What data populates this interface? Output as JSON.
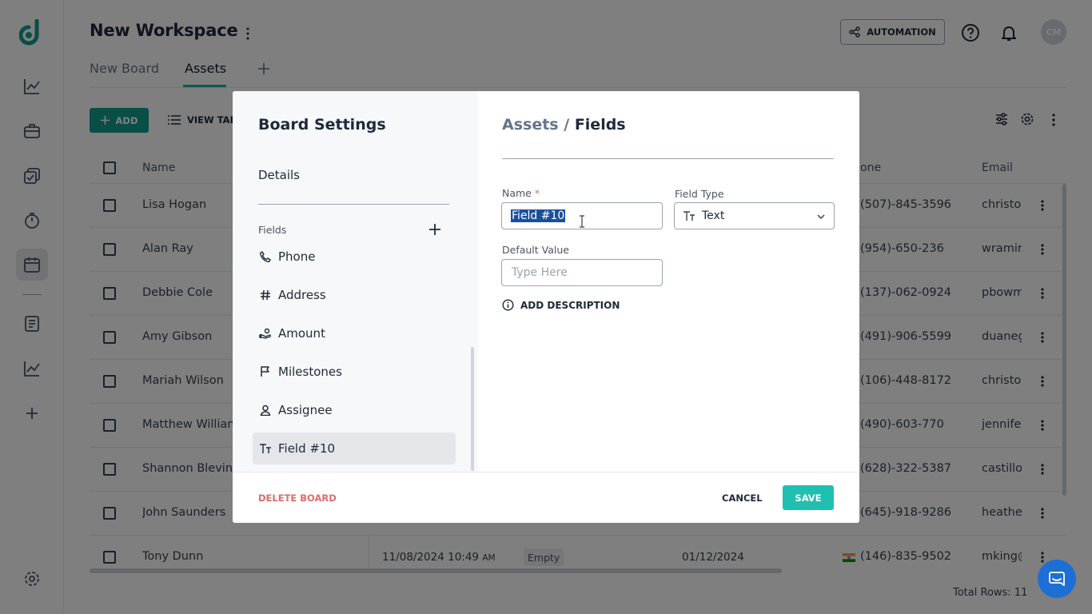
{
  "workspace": {
    "title": "New Workspace",
    "tabs": [
      {
        "label": "New Board"
      },
      {
        "label": "Assets"
      }
    ],
    "automation_label": "AUTOMATION",
    "avatar_initials": "CM"
  },
  "toolbar": {
    "add_label": "ADD",
    "view_table_label": "VIEW TAB"
  },
  "table": {
    "headers": {
      "name": "Name",
      "phone": "one",
      "email": "Email"
    },
    "rows": [
      {
        "name": "Lisa Hogan",
        "phone": "(507)-845-3596",
        "email": "christo"
      },
      {
        "name": "Alan Ray",
        "phone": "(954)-650-236",
        "email": "wramir"
      },
      {
        "name": "Debbie Cole",
        "phone": "(137)-062-0924",
        "email": "pbowm"
      },
      {
        "name": "Amy Gibson",
        "phone": "(491)-906-5599",
        "email": "duaneg"
      },
      {
        "name": "Mariah Wilson",
        "phone": "(106)-448-8172",
        "email": "christo"
      },
      {
        "name": "Matthew William",
        "phone": "(490)-603-770",
        "email": "jennifer"
      },
      {
        "name": "Shannon Blevins",
        "phone": "(628)-322-5387",
        "email": "castillo"
      },
      {
        "name": "John Saunders",
        "phone": "(645)-918-9286",
        "email": "heathe"
      },
      {
        "name": "Tony Dunn",
        "date": "11/08/2024 10:49",
        "date_suffix": "AM",
        "status": "Empty",
        "date2": "01/12/2024",
        "phone": "(146)-835-9502",
        "email": "mking@"
      }
    ],
    "total_rows": "Total Rows: 11"
  },
  "modal": {
    "title": "Board Settings",
    "details_label": "Details",
    "fields_label": "Fields",
    "fields": [
      {
        "label": "Phone",
        "icon": "phone-icon"
      },
      {
        "label": "Address",
        "icon": "hash-icon"
      },
      {
        "label": "Amount",
        "icon": "money-hand-icon"
      },
      {
        "label": "Milestones",
        "icon": "flag-icon"
      },
      {
        "label": "Assignee",
        "icon": "user-icon"
      },
      {
        "label": "Field #10",
        "icon": "text-type-icon",
        "active": true
      }
    ],
    "breadcrumb": {
      "parent": "Assets",
      "sep": "/",
      "current": "Fields"
    },
    "form": {
      "name_label": "Name",
      "required_mark": "*",
      "name_value": "Field #10",
      "field_type_label": "Field Type",
      "field_type_value": "Text",
      "default_value_label": "Default Value",
      "default_value_placeholder": "Type Here",
      "add_description_label": "ADD DESCRIPTION"
    },
    "footer": {
      "delete_label": "DELETE BOARD",
      "cancel_label": "CANCEL",
      "save_label": "SAVE"
    }
  },
  "colors": {
    "brand": "#0f9f8f",
    "save": "#1fc0b0",
    "danger": "#e26a6a",
    "selection": "#1b4f9c"
  }
}
